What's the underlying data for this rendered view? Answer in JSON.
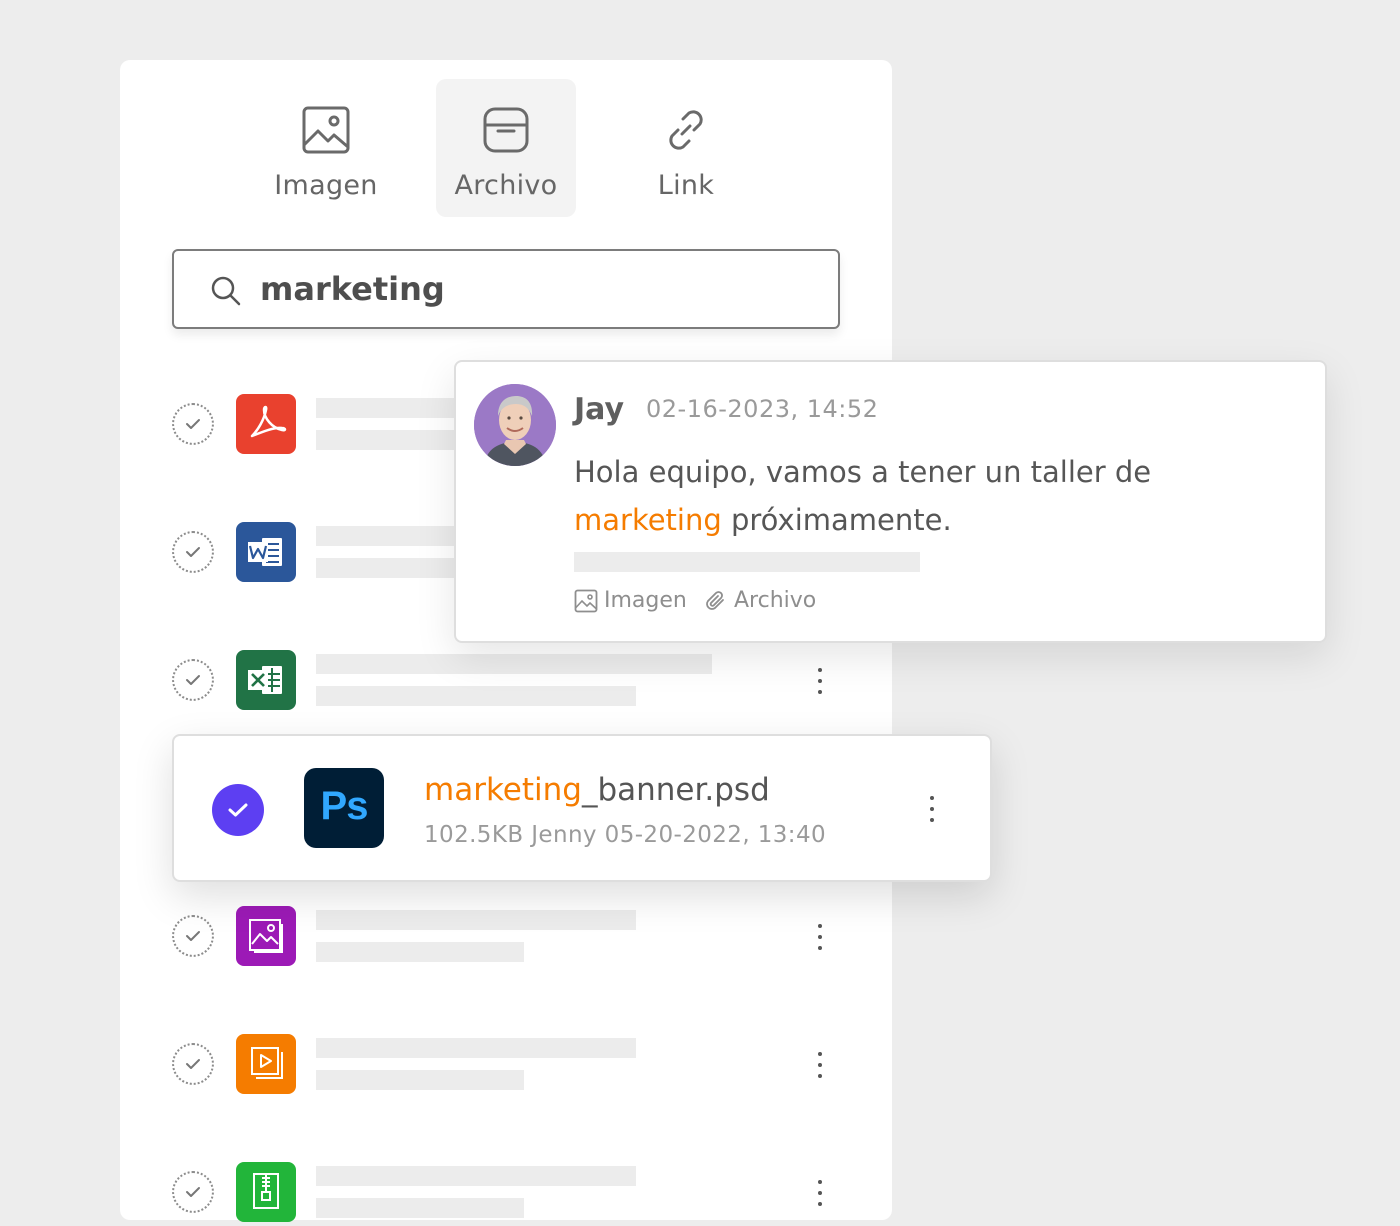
{
  "tabs": [
    {
      "label": "Imagen",
      "icon": "image-icon",
      "active": false
    },
    {
      "label": "Archivo",
      "icon": "file-icon",
      "active": true
    },
    {
      "label": "Link",
      "icon": "link-icon",
      "active": false
    }
  ],
  "search": {
    "value": "marketing",
    "icon": "search-icon"
  },
  "files": [
    {
      "type": "pdf",
      "icon": "pdf-file-icon",
      "color": "#e9412e"
    },
    {
      "type": "word",
      "icon": "word-file-icon",
      "color": "#2b579a"
    },
    {
      "type": "excel",
      "icon": "excel-file-icon",
      "color": "#217346"
    },
    {
      "type": "image",
      "icon": "image-file-icon",
      "color": "#9c1ab6"
    },
    {
      "type": "video",
      "icon": "video-file-icon",
      "color": "#f57c00"
    },
    {
      "type": "archive",
      "icon": "zip-file-icon",
      "color": "#22b53a"
    }
  ],
  "message": {
    "author": "Jay",
    "timestamp": "02-16-2023, 14:52",
    "text_before": "Hola equipo, vamos a tener un taller de ",
    "highlight": "marketing",
    "text_after": " próximamente.",
    "attachments": [
      {
        "label": "Imagen",
        "icon": "image-icon"
      },
      {
        "label": "Archivo",
        "icon": "paperclip-icon"
      }
    ],
    "avatar_bg": "#9b79c6"
  },
  "selected_file": {
    "icon_text": "Ps",
    "name_highlight": "marketing",
    "name_rest": "_banner.psd",
    "size": "102.5KB",
    "owner": "Jenny",
    "date": "05-20-2022, 13:40",
    "check_color": "#5d3ff2"
  },
  "colors": {
    "highlight": "#f57c00",
    "accent": "#5d3ff2"
  }
}
